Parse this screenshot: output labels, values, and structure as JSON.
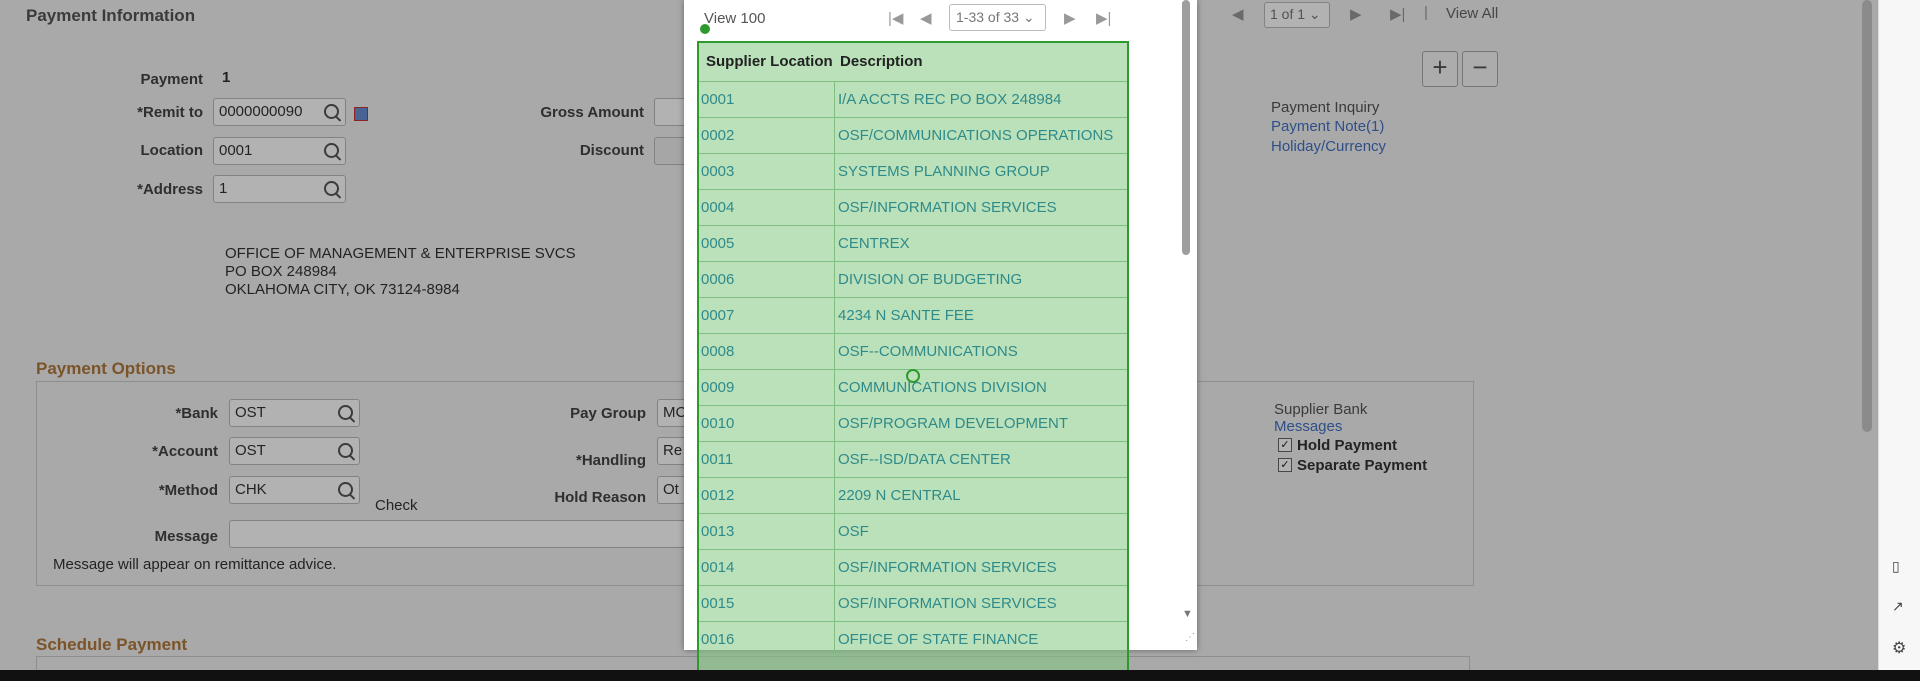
{
  "payment_info": {
    "title": "Payment Information",
    "payment_label": "Payment",
    "payment_value": "1",
    "remit_label": "*Remit to",
    "remit_value": "0000000090",
    "location_label": "Location",
    "location_value": "0001",
    "address_label": "*Address",
    "address_value": "1",
    "gross_label": "Gross Amount",
    "discount_label": "Discount",
    "address_lines": [
      "OFFICE OF MANAGEMENT & ENTERPRISE SVCS",
      "PO BOX 248984",
      "OKLAHOMA CITY, OK  73124-8984"
    ],
    "pager_value": "1 of 1",
    "view_all": "View All",
    "payment_inquiry": "Payment Inquiry",
    "payment_note": "Payment Note(1)",
    "holiday_currency": "Holiday/Currency"
  },
  "payment_options": {
    "title": "Payment Options",
    "bank_label": "*Bank",
    "bank_value": "OST",
    "account_label": "*Account",
    "account_value": "OST",
    "method_label": "*Method",
    "method_value": "CHK",
    "method_desc": "Check",
    "message_label": "Message",
    "message_note": "Message will appear on remittance advice.",
    "pay_group_label": "Pay Group",
    "pay_group_value": "MC",
    "handling_label": "*Handling",
    "handling_value": "Re",
    "hold_reason_label": "Hold Reason",
    "hold_reason_value": "Ot",
    "supplier_bank": "Supplier Bank",
    "messages_link": "Messages",
    "hold_payment": "Hold Payment",
    "separate_payment": "Separate Payment"
  },
  "schedule_payment": {
    "title": "Schedule Payment"
  },
  "popup": {
    "view_label": "View 100",
    "range_value": "1-33 of 33",
    "columns": [
      "Supplier Location",
      "Description"
    ],
    "rows": [
      [
        "0001",
        "I/A ACCTS REC PO BOX 248984"
      ],
      [
        "0002",
        "OSF/COMMUNICATIONS OPERATIONS"
      ],
      [
        "0003",
        "SYSTEMS PLANNING GROUP"
      ],
      [
        "0004",
        "OSF/INFORMATION SERVICES"
      ],
      [
        "0005",
        "CENTREX"
      ],
      [
        "0006",
        "DIVISION OF BUDGETING"
      ],
      [
        "0007",
        "4234 N SANTE FEE"
      ],
      [
        "0008",
        "OSF--COMMUNICATIONS"
      ],
      [
        "0009",
        "COMMUNICATIONS DIVISION"
      ],
      [
        "0010",
        "OSF/PROGRAM DEVELOPMENT"
      ],
      [
        "0011",
        "OSF--ISD/DATA CENTER"
      ],
      [
        "0012",
        "2209 N CENTRAL"
      ],
      [
        "0013",
        "OSF"
      ],
      [
        "0014",
        "OSF/INFORMATION SERVICES"
      ],
      [
        "0015",
        "OSF/INFORMATION SERVICES"
      ],
      [
        "0016",
        "OFFICE OF STATE FINANCE"
      ]
    ]
  },
  "colors": {
    "accent": "#b07a3c",
    "link": "#4472c4",
    "grid_text": "#2f8a8a",
    "highlight": "#2e9a2e"
  }
}
